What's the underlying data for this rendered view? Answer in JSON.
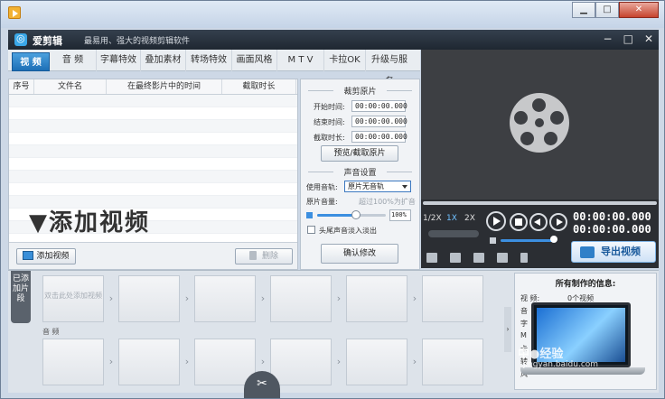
{
  "app": {
    "name": "爱剪辑",
    "slogan": "最易用、强大的视频剪辑软件"
  },
  "window_controls": {
    "minimize": "▁",
    "maximize": "□",
    "close": "✕"
  },
  "app_controls": {
    "minimize": "−",
    "maximize": "□",
    "close": "✕"
  },
  "tabs": [
    {
      "label": "视 频",
      "active": true
    },
    {
      "label": "音 频"
    },
    {
      "label": "字幕特效"
    },
    {
      "label": "叠加素材"
    },
    {
      "label": "转场特效"
    },
    {
      "label": "画面风格"
    },
    {
      "label": "M T V"
    },
    {
      "label": "卡拉OK"
    },
    {
      "label": "升级与服务"
    }
  ],
  "file_list": {
    "columns": [
      "序号",
      "文件名",
      "在最终影片中的时间",
      "截取时长"
    ],
    "overlay_title": "▼添加视频",
    "add_button": "添加视频",
    "delete_button": "删除"
  },
  "clip_settings": {
    "section_title": "裁剪原片",
    "start_label": "开始时间:",
    "start_value": "00:00:00.000",
    "end_label": "结束时间:",
    "end_value": "00:00:00.000",
    "duration_label": "截取时长:",
    "duration_value": "00:00:00.000",
    "preview_button": "预览/截取原片",
    "audio_section_title": "声音设置",
    "track_label": "使用音轨:",
    "track_value": "原片无音轨",
    "volume_label": "原片音量:",
    "volume_hint": "超过100%为扩音",
    "volume_value": "100%",
    "fade_label": "头尾声音淡入淡出",
    "confirm_button": "确认修改"
  },
  "player": {
    "speeds": [
      "1/2X",
      "1X",
      "2X"
    ],
    "active_speed": "1X",
    "time_current": "00:00:00.000",
    "time_total": "00:00:00.000",
    "export_button": "导出视频"
  },
  "timeline": {
    "side_tab": "已添加片段",
    "placeholder_clip": "双击此处添加视频",
    "audio_label": "音 频",
    "collapse_arrow": "›"
  },
  "info_panel": {
    "title": "所有制作的信息:",
    "video_label": "视    频:",
    "video_value": "0个视频",
    "partial_rows": [
      "音",
      "字",
      "M",
      "卡",
      "转",
      "风"
    ]
  },
  "watermark": {
    "logo": "中●经验",
    "url": "jingyan.baidu.com"
  }
}
